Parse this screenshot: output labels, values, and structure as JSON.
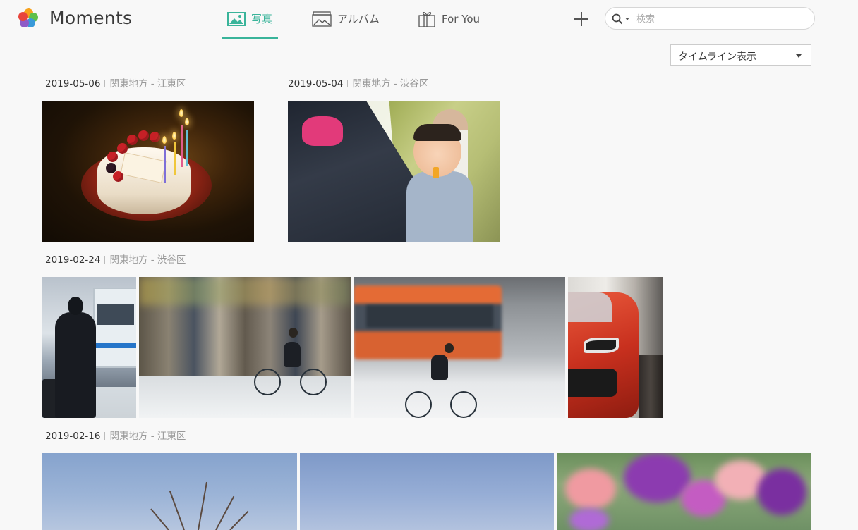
{
  "app": {
    "title": "Moments"
  },
  "nav": {
    "tabs": [
      {
        "label": "写真",
        "icon": "photo-icon",
        "active": true
      },
      {
        "label": "アルバム",
        "icon": "album-icon",
        "active": false
      },
      {
        "label": "For You",
        "icon": "gift-icon",
        "active": false
      }
    ]
  },
  "toolbar": {
    "add_icon": "plus-icon"
  },
  "search": {
    "placeholder": "検索",
    "value": "",
    "icon": "search-icon"
  },
  "view_select": {
    "selected": "タイムライン表示"
  },
  "moments": [
    {
      "date": "2019-05-06",
      "location": "関東地方 - 江東区",
      "photos": [
        "birthday-cake-photo"
      ]
    },
    {
      "date": "2019-05-04",
      "location": "関東地方 - 渋谷区",
      "photos": [
        "baby-stroller-photo"
      ]
    },
    {
      "date": "2019-02-24",
      "location": "関東地方 - 渋谷区",
      "photos": [
        "man-silhouette-bus-photo",
        "cyclist-crowd-blur-photo",
        "cyclist-orange-bus-photo",
        "red-car-photo"
      ]
    },
    {
      "date": "2019-02-16",
      "location": "関東地方 - 江東区",
      "photos": [
        "tree-blossom-sky-photo",
        "blue-sky-photo",
        "purple-flowers-photo"
      ]
    }
  ],
  "colors": {
    "accent": "#39b49a",
    "background": "#f8f8f8"
  }
}
